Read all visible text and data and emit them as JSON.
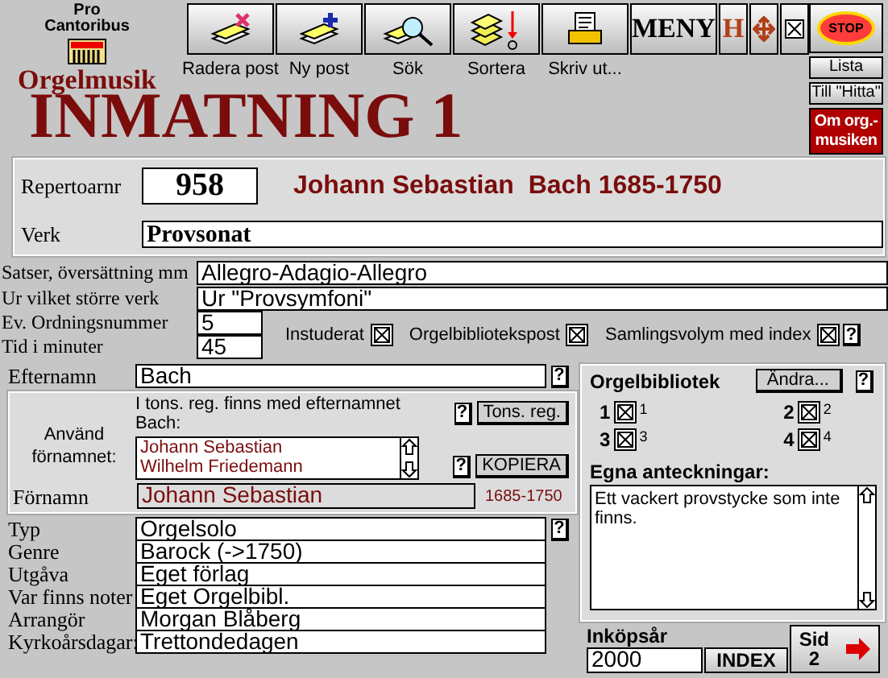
{
  "logo": {
    "line1": "Pro",
    "line2": "Cantoribus"
  },
  "app_name": "Orgelmusik",
  "page_title": "INMATNING 1",
  "toolbar": [
    {
      "label": "Radera post",
      "kind": "delete"
    },
    {
      "label": "Ny post",
      "kind": "new"
    },
    {
      "label": "Sök",
      "kind": "search"
    },
    {
      "label": "Sortera",
      "kind": "sort"
    },
    {
      "label": "Skriv ut...",
      "kind": "print"
    }
  ],
  "menu_button": "MENY",
  "h_button": "H",
  "stop_button": "STOP",
  "side_buttons": [
    {
      "label": "Lista",
      "kind": "plain"
    },
    {
      "label": "Till \"Hitta\"",
      "kind": "plain"
    },
    {
      "label": "Om org.-musiken",
      "kind": "highlight"
    }
  ],
  "record": {
    "number_label": "Repertoarnr",
    "number": "958",
    "composer_heading": "Johann Sebastian  Bach 1685-1750",
    "work_label": "Verk",
    "work": "Provsonat"
  },
  "fields": [
    {
      "label": "Satser, översättning mm",
      "value": "Allegro-Adagio-Allegro"
    },
    {
      "label": "Ur vilket större verk",
      "value": "Ur \"Provsymfoni\""
    }
  ],
  "short_fields": [
    {
      "label": "Ev. Ordningsnummer",
      "value": "5"
    },
    {
      "label": "Tid i minuter",
      "value": "45"
    }
  ],
  "flags": [
    {
      "label": "Instuderat",
      "checked": true
    },
    {
      "label": "Orgelbibliotekspost",
      "checked": true
    },
    {
      "label": "Samlingsvolym med index",
      "checked": true
    }
  ],
  "flags_help": "?",
  "surname": {
    "label": "Efternamn",
    "value": "Bach",
    "help": "?"
  },
  "register": {
    "use_label": "Använd förnamnet:",
    "info": "I tons. reg. finns med efternamnet Bach:",
    "names": [
      "Johann Sebastian",
      "Wilhelm Friedemann"
    ],
    "register_help": "?",
    "register_button": "Tons. reg.",
    "copy_help": "?",
    "copy_button": "KOPIERA",
    "first_name_label": "Förnamn",
    "first_name": "Johann Sebastian",
    "years": "1685-1750"
  },
  "details": [
    {
      "label": "Typ",
      "value": "Orgelsolo",
      "help": "?"
    },
    {
      "label": "Genre",
      "value": "Barock (->1750)"
    },
    {
      "label": "Utgåva",
      "value": "Eget förlag"
    },
    {
      "label": "Var finns noter",
      "value": "Eget Orgelbibl."
    },
    {
      "label": "Arrangör",
      "value": "Morgan Blåberg"
    },
    {
      "label": "Kyrkoårsdagar:",
      "value": "Trettondedagen"
    }
  ],
  "library": {
    "title": "Orgelbibliotek",
    "change_button": "Ändra...",
    "help": "?",
    "items": [
      {
        "number": "1",
        "checked": true,
        "note": "1"
      },
      {
        "number": "2",
        "checked": true,
        "note": "2"
      },
      {
        "number": "3",
        "checked": true,
        "note": "3"
      },
      {
        "number": "4",
        "checked": true,
        "note": "4"
      }
    ],
    "notes_label": "Egna anteckningar:",
    "notes": "Ett vackert provstycke som inte finns."
  },
  "purchase": {
    "label": "Inköpsår",
    "value": "2000"
  },
  "index_button": "INDEX",
  "page_button": {
    "label": "Sid",
    "number": "2"
  }
}
